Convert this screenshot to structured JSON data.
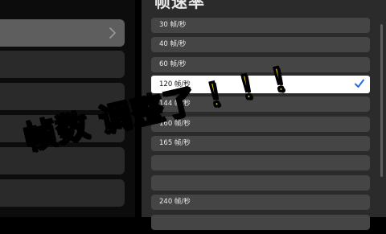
{
  "panel": {
    "title": "帧速率"
  },
  "left_items": [
    {
      "id": "item-1",
      "selected": true
    },
    {
      "id": "item-2",
      "selected": false
    },
    {
      "id": "item-3",
      "selected": false
    },
    {
      "id": "item-4",
      "selected": false
    },
    {
      "id": "item-5",
      "selected": false
    },
    {
      "id": "item-6",
      "selected": false
    }
  ],
  "fps_options": [
    {
      "label": "30 帧/秒",
      "selected": false
    },
    {
      "label": "40 帧/秒",
      "selected": false
    },
    {
      "label": "60 帧/秒",
      "selected": false
    },
    {
      "label": "120 帧/秒",
      "selected": true
    },
    {
      "label": "144 帧/秒",
      "selected": false
    },
    {
      "label": "160 帧/秒",
      "selected": false
    },
    {
      "label": "165 帧/秒",
      "selected": false
    },
    {
      "label": "",
      "selected": false
    },
    {
      "label": "",
      "selected": false
    },
    {
      "label": "240 帧/秒",
      "selected": false
    },
    {
      "label": "",
      "selected": false
    }
  ],
  "caption": {
    "part1": "帧数",
    "part2": "调整了",
    "part3": "！！！"
  },
  "colors": {
    "accent": "#1f6fe8",
    "caption": "#ffd400"
  },
  "icons": {
    "chevron": "chevron-right-icon",
    "check": "checkmark-icon"
  }
}
